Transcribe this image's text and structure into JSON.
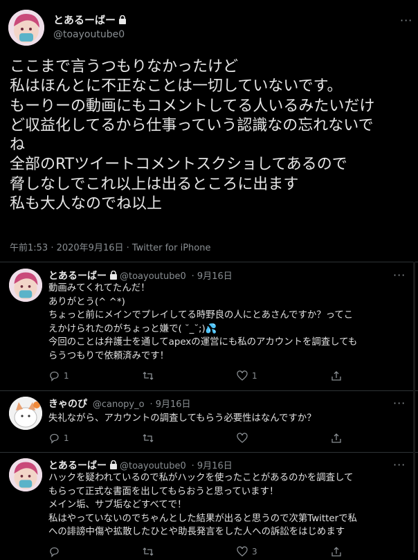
{
  "main_tweet": {
    "author_name": "とあるーばー",
    "handle": "@toayoutube0",
    "text": "ここまで言うつもりなかったけど\n私はほんとに不正なことは一切していないです。\nもーりーの動画にもコメントしてる人いるみたいだけ\nど収益化してるから仕事っていう認識なの忘れないで\nね\n全部のRTツイートコメントスクショしてあるので\n脅しなしでこれ以上は出るところに出ます\n私も大人なのでね以上",
    "meta": "午前1:53 · 2020年9月16日 · Twitter for iPhone"
  },
  "replies": [
    {
      "author_name": "とあるーばー",
      "handle": "@toayoutube0",
      "date": "· 9月16日",
      "text": "動画みてくれてたんだ！\nありがとう(^ ^*)\nちょっと前にメインでプレイしてる時野良の人にとあさんですか？ってこ\nえかけられたのがちょっと嫌で( ˘_˘;)💦\n今回のことは弁護士を通してapexの運営にも私のアカウントを調査しても\nらうつもりで依頼済みです！",
      "reply_count": "1",
      "retweet_count": "",
      "like_count": "1"
    },
    {
      "author_name": "きゃのぴ",
      "handle": "@canopy_o",
      "date": "· 9月16日",
      "text": "失礼ながら、アカウントの調査してもらう必要性はなんですか？",
      "reply_count": "1",
      "retweet_count": "",
      "like_count": ""
    },
    {
      "author_name": "とあるーばー",
      "handle": "@toayoutube0",
      "date": "· 9月16日",
      "text": "ハックを疑われているので私がハックを使ったことがあるのかを調査して\nもらって正式な書面を出してもらおうと思っています！\nメイン垢、サブ垢などすべてで！\n私はやっていないのでちゃんとした結果が出ると思うので次第Twitterで私\nへの誹謗中傷や拡散したひとや助長発言をした人への訴訟をはじめます",
      "reply_count": "",
      "retweet_count": "",
      "like_count": "3"
    }
  ],
  "icons": {
    "lock": "lock-icon",
    "more": "more-icon",
    "reply": "reply-icon",
    "retweet": "retweet-icon",
    "like": "like-icon",
    "share": "share-icon"
  },
  "colors": {
    "background": "#000000",
    "text": "#d9d9d9",
    "muted": "#8a8f93",
    "divider": "#2f3336"
  }
}
